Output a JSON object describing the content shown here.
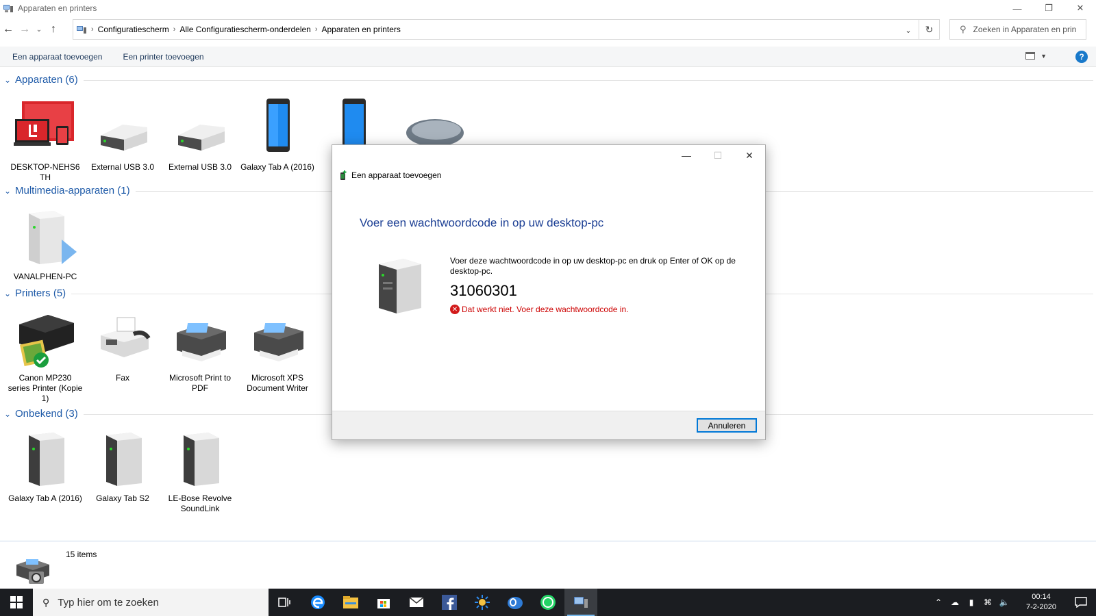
{
  "window": {
    "title": "Apparaten en printers"
  },
  "address": {
    "crumbs": [
      "Configuratiescherm",
      "Alle Configuratiescherm-onderdelen",
      "Apparaten en printers"
    ],
    "search_placeholder": "Zoeken in Apparaten en prin..."
  },
  "commands": {
    "add_device": "Een apparaat toevoegen",
    "add_printer": "Een printer toevoegen"
  },
  "groups": {
    "devices": {
      "title": "Apparaten (6)",
      "items": [
        "DESKTOP-NEHS6 TH",
        "External USB 3.0",
        "External USB 3.0",
        "Galaxy Tab A (2016)"
      ]
    },
    "multimedia": {
      "title": "Multimedia-apparaten (1)",
      "items": [
        "VANALPHEN-PC"
      ]
    },
    "printers": {
      "title": "Printers (5)",
      "items": [
        "Canon MP230 series Printer (Kopie 1)",
        "Fax",
        "Microsoft Print to PDF",
        "Microsoft XPS Document Writer"
      ]
    },
    "unknown": {
      "title": "Onbekend (3)",
      "items": [
        "Galaxy Tab A (2016)",
        "Galaxy Tab S2",
        "LE-Bose Revolve SoundLink"
      ]
    }
  },
  "status": {
    "count": "15 items"
  },
  "dialog": {
    "title": "Een apparaat toevoegen",
    "heading": "Voer een wachtwoordcode in op uw desktop-pc",
    "message": "Voer deze wachtwoordcode in op uw desktop-pc en druk op Enter of OK op de desktop-pc.",
    "code": "31060301",
    "error": "Dat werkt niet. Voer deze wachtwoordcode in.",
    "cancel_label": "Annuleren"
  },
  "taskbar": {
    "search_placeholder": "Typ hier om te zoeken",
    "time": "00:14",
    "date": "7-2-2020"
  },
  "colors": {
    "link_blue": "#1e5aa8",
    "dialog_heading": "#1c3f94",
    "error_red": "#c00000",
    "taskbar": "#1b1d21",
    "accent": "#0078d7"
  }
}
